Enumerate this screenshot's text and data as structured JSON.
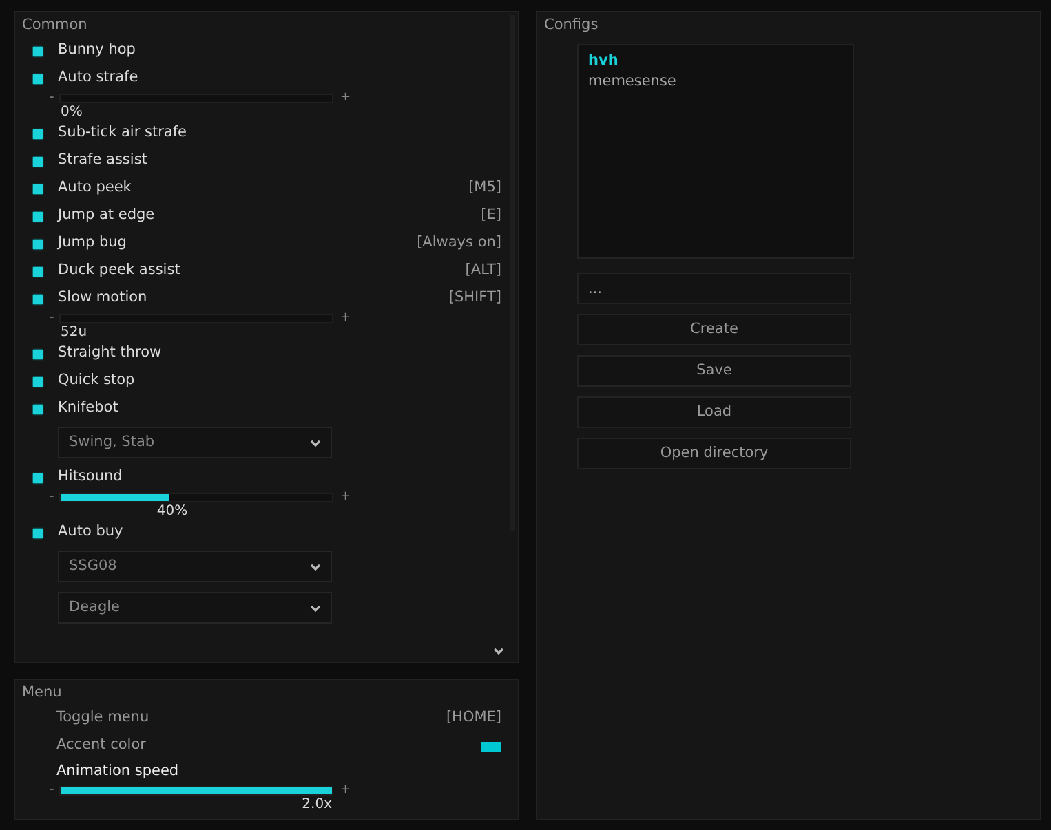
{
  "common": {
    "title": "Common",
    "items": [
      {
        "kind": "checkbox",
        "label": "Bunny hop",
        "checked": true
      },
      {
        "kind": "checkbox",
        "label": "Auto strafe",
        "checked": true
      },
      {
        "kind": "slider",
        "minus": "-",
        "plus": "+",
        "reading": "0%"
      },
      {
        "kind": "checkbox",
        "label": "Sub-tick air strafe",
        "checked": true
      },
      {
        "kind": "checkbox",
        "label": "Strafe assist",
        "checked": true
      },
      {
        "kind": "checkbox",
        "label": "Auto peek",
        "checked": true,
        "keybind": "[M5]"
      },
      {
        "kind": "checkbox",
        "label": "Jump at edge",
        "checked": true,
        "keybind": "[E]"
      },
      {
        "kind": "checkbox",
        "label": "Jump bug",
        "checked": true,
        "keybind": "[Always on]"
      },
      {
        "kind": "checkbox",
        "label": "Duck peek assist",
        "checked": true,
        "keybind": "[ALT]"
      },
      {
        "kind": "checkbox",
        "label": "Slow motion",
        "checked": true,
        "keybind": "[SHIFT]"
      },
      {
        "kind": "slider",
        "minus": "-",
        "plus": "+",
        "reading": "52u"
      },
      {
        "kind": "checkbox",
        "label": "Straight throw",
        "checked": true
      },
      {
        "kind": "checkbox",
        "label": "Quick stop",
        "checked": true
      },
      {
        "kind": "checkbox",
        "label": "Knifebot",
        "checked": true
      },
      {
        "kind": "dropdown",
        "value": "Swing, Stab"
      },
      {
        "kind": "checkbox",
        "label": "Hitsound",
        "checked": true
      },
      {
        "kind": "slider",
        "minus": "-",
        "plus": "+",
        "reading": "40%",
        "level": 0.4
      },
      {
        "kind": "checkbox",
        "label": "Auto buy",
        "checked": true
      },
      {
        "kind": "dropdown",
        "value": "SSG08"
      },
      {
        "kind": "dropdown",
        "value": "Deagle"
      }
    ]
  },
  "menu": {
    "title": "Menu",
    "items": [
      {
        "kind": "keybind",
        "label": "Toggle menu",
        "keybind": "[HOME]"
      },
      {
        "kind": "color",
        "label": "Accent color",
        "color": "#00c8d2"
      },
      {
        "kind": "slider",
        "label": "Animation speed",
        "minus": "-",
        "plus": "+",
        "reading": "2.0x",
        "level": 1
      }
    ]
  },
  "configs": {
    "title": "Configs",
    "items": [
      {
        "label": "hvh",
        "selected": true
      },
      {
        "label": "memesense",
        "selected": false
      }
    ],
    "name_field": {
      "placeholder": "..."
    },
    "buttons": [
      "Create",
      "Save",
      "Load",
      "Open directory"
    ]
  }
}
